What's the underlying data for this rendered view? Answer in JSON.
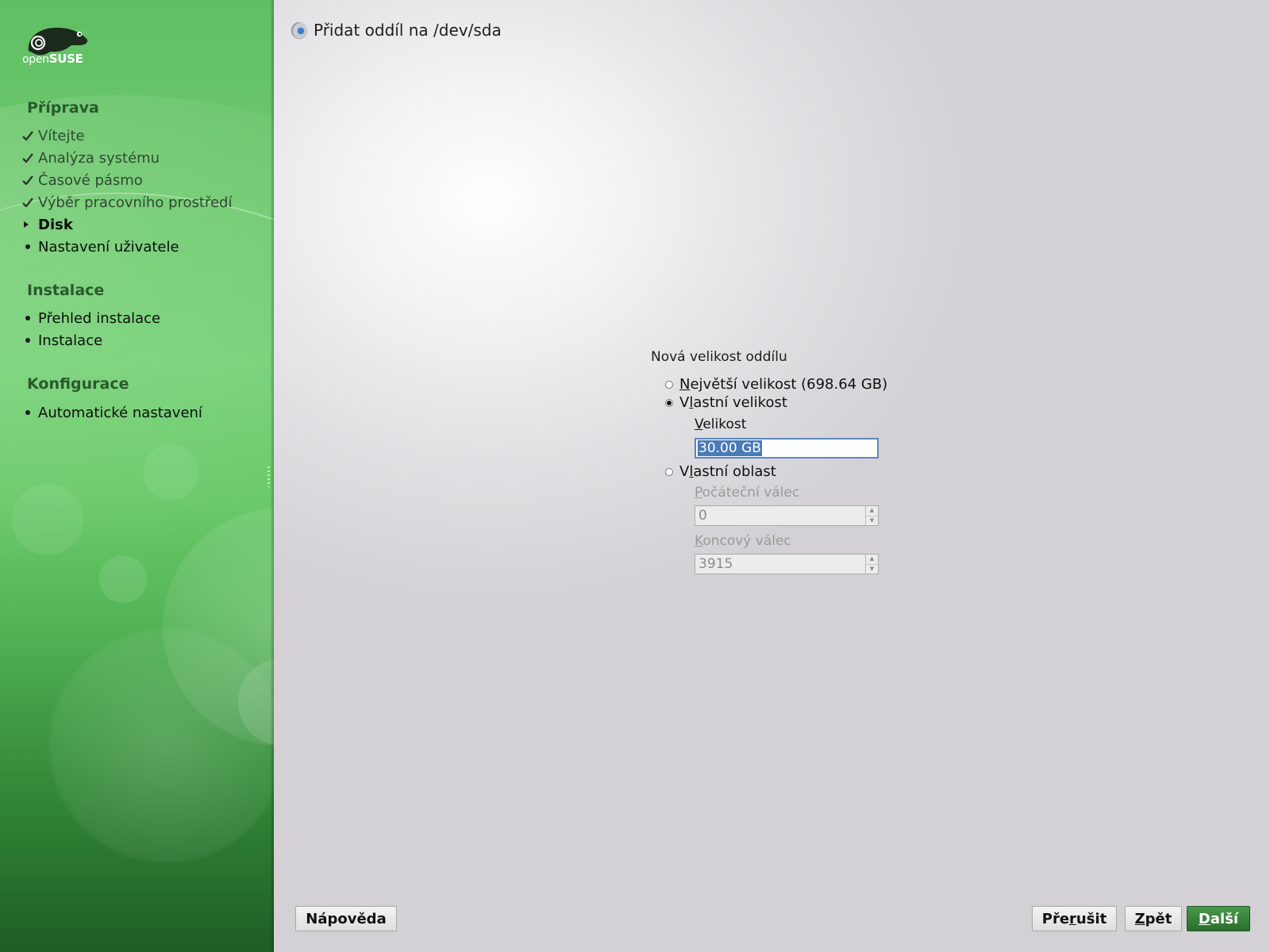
{
  "brand": {
    "logo_prefix": "open",
    "logo_suffix": "SUSE",
    "accent_color": "#3d9140",
    "primary_button_color": "#2a6e2d"
  },
  "sidebar": {
    "sections": [
      {
        "title": "Příprava",
        "steps": [
          {
            "label": "Vítejte",
            "status": "done",
            "icon": "check-icon"
          },
          {
            "label": "Analýza systému",
            "status": "done",
            "icon": "check-icon"
          },
          {
            "label": "Časové pásmo",
            "status": "done",
            "icon": "check-icon"
          },
          {
            "label": "Výběr pracovního prostředí",
            "status": "done",
            "icon": "check-icon"
          },
          {
            "label": "Disk",
            "status": "current",
            "icon": "arrow-right-icon"
          },
          {
            "label": "Nastavení uživatele",
            "status": "todo",
            "icon": "bullet-icon"
          }
        ]
      },
      {
        "title": "Instalace",
        "steps": [
          {
            "label": "Přehled instalace",
            "status": "todo",
            "icon": "bullet-icon"
          },
          {
            "label": "Instalace",
            "status": "todo",
            "icon": "bullet-icon"
          }
        ]
      },
      {
        "title": "Konfigurace",
        "steps": [
          {
            "label": "Automatické nastavení",
            "status": "todo",
            "icon": "bullet-icon"
          }
        ]
      }
    ]
  },
  "dialog": {
    "title": "Přidat oddíl na /dev/sda",
    "title_icon": "disk-icon",
    "group_label": "Nová velikost oddílu",
    "options": {
      "max_size": {
        "key": "N",
        "rest": "ejvětší velikost (698.64 GB)",
        "checked": false
      },
      "custom_size": {
        "pre": "V",
        "key": "l",
        "rest": "astní velikost",
        "checked": true
      },
      "custom_region": {
        "pre": "V",
        "key": "l",
        "rest": "astní oblast",
        "checked": false
      }
    },
    "size": {
      "label_key": "V",
      "label_rest": "elikost",
      "value_selected": "30.00 GB"
    },
    "start_cylinder": {
      "label_key": "P",
      "label_rest": "očáteční válec",
      "value": "0",
      "enabled": false
    },
    "end_cylinder": {
      "label_key": "K",
      "label_rest": "oncový válec",
      "value": "3915",
      "enabled": false
    }
  },
  "buttons": {
    "help": "Nápověda",
    "abort_pre": "Pře",
    "abort_key": "r",
    "abort_rest": "ušit",
    "back_key": "Z",
    "back_rest": "pět",
    "next_key": "D",
    "next_rest": "alší"
  }
}
